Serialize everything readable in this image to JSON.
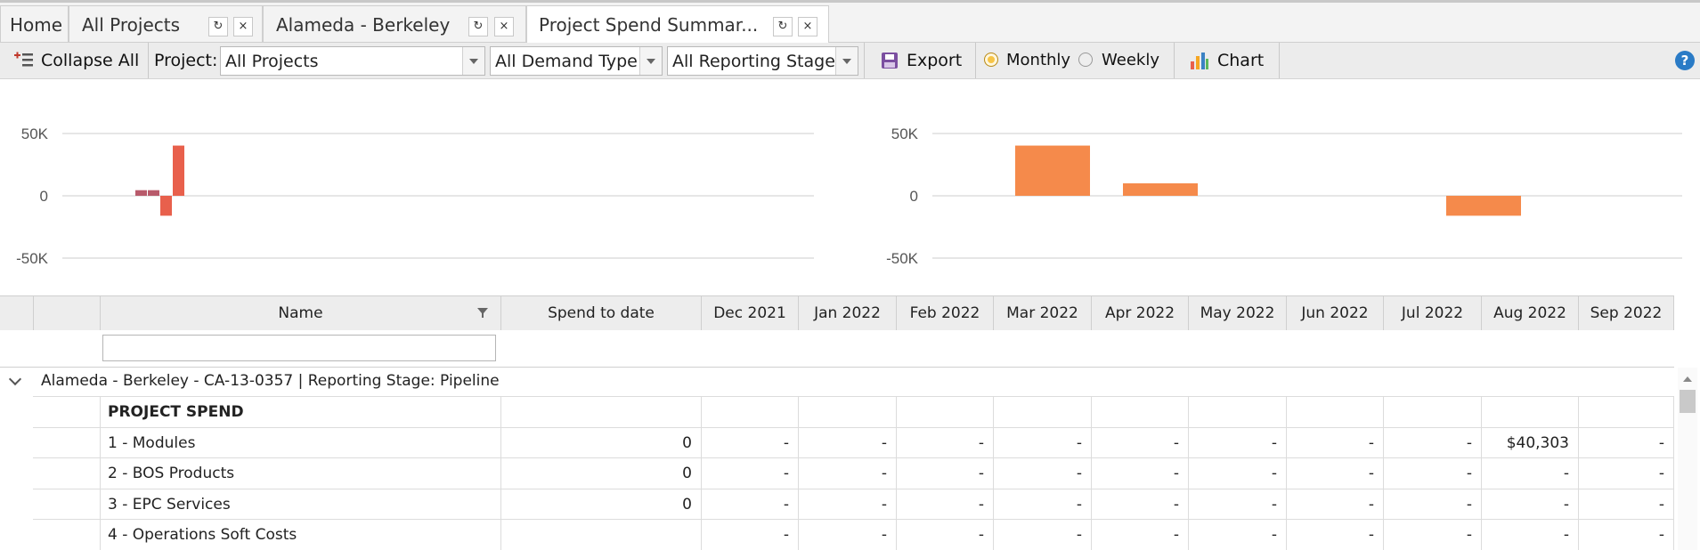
{
  "tabs": [
    {
      "label": "Home"
    },
    {
      "label": "All Projects"
    },
    {
      "label": "Alameda - Berkeley"
    },
    {
      "label": "Project Spend Summar..."
    }
  ],
  "tab_icons": {
    "refresh": "↻",
    "close": "×"
  },
  "toolbar": {
    "collapse_label": "Collapse All",
    "project_label": "Project:",
    "project_value": "All Projects",
    "demand_type_value": "All Demand Type",
    "reporting_stage_value": "All Reporting Stage",
    "export_label": "Export",
    "monthly_label": "Monthly",
    "weekly_label": "Weekly",
    "selected_period": "Monthly",
    "chart_label": "Chart",
    "help_label": "?"
  },
  "chart_data": [
    {
      "type": "bar",
      "ylim": [
        -60000,
        60000
      ],
      "yticks": [
        {
          "value": 50000,
          "label": "50K"
        },
        {
          "value": 0,
          "label": "0"
        },
        {
          "value": -50000,
          "label": "-50K"
        }
      ],
      "series": [
        {
          "color": "#b85a6b",
          "x": [
            1,
            2
          ],
          "values": [
            4500,
            4500
          ]
        },
        {
          "color": "#e8604c",
          "x": [
            3,
            4
          ],
          "values": [
            -16000,
            40303
          ]
        }
      ],
      "x_count": 60
    },
    {
      "type": "bar",
      "ylim": [
        -60000,
        60000
      ],
      "yticks": [
        {
          "value": 50000,
          "label": "50K"
        },
        {
          "value": 0,
          "label": "0"
        },
        {
          "value": -50000,
          "label": "-50K"
        }
      ],
      "series": [
        {
          "color": "#f58a4b",
          "x": [
            0,
            1,
            4
          ],
          "values": [
            40303,
            10000,
            -16000
          ]
        }
      ],
      "x_count": 7
    }
  ],
  "grid": {
    "columns": [
      "",
      "",
      "Name",
      "Spend to date",
      "Dec 2021",
      "Jan 2022",
      "Feb 2022",
      "Mar 2022",
      "Apr 2022",
      "May 2022",
      "Jun 2022",
      "Jul 2022",
      "Aug 2022",
      "Sep 2022"
    ],
    "group_label": "Alameda - Berkeley - CA-13-0357 | Reporting Stage: Pipeline",
    "rows": [
      {
        "name": "PROJECT SPEND",
        "bold": true,
        "spend": "",
        "months": [
          "",
          "",
          "",
          "",
          "",
          "",
          "",
          "",
          "",
          ""
        ]
      },
      {
        "name": "1 - Modules",
        "bold": false,
        "spend": "0",
        "months": [
          "-",
          "-",
          "-",
          "-",
          "-",
          "-",
          "-",
          "-",
          "$40,303",
          "-"
        ]
      },
      {
        "name": "2 - BOS Products",
        "bold": false,
        "spend": "0",
        "months": [
          "-",
          "-",
          "-",
          "-",
          "-",
          "-",
          "-",
          "-",
          "-",
          "-"
        ]
      },
      {
        "name": "3 - EPC Services",
        "bold": false,
        "spend": "0",
        "months": [
          "-",
          "-",
          "-",
          "-",
          "-",
          "-",
          "-",
          "-",
          "-",
          "-"
        ]
      },
      {
        "name": "4 - Operations Soft Costs",
        "bold": false,
        "spend": "",
        "months": [
          "-",
          "-",
          "-",
          "-",
          "-",
          "-",
          "-",
          "-",
          "-",
          "-"
        ]
      }
    ]
  }
}
